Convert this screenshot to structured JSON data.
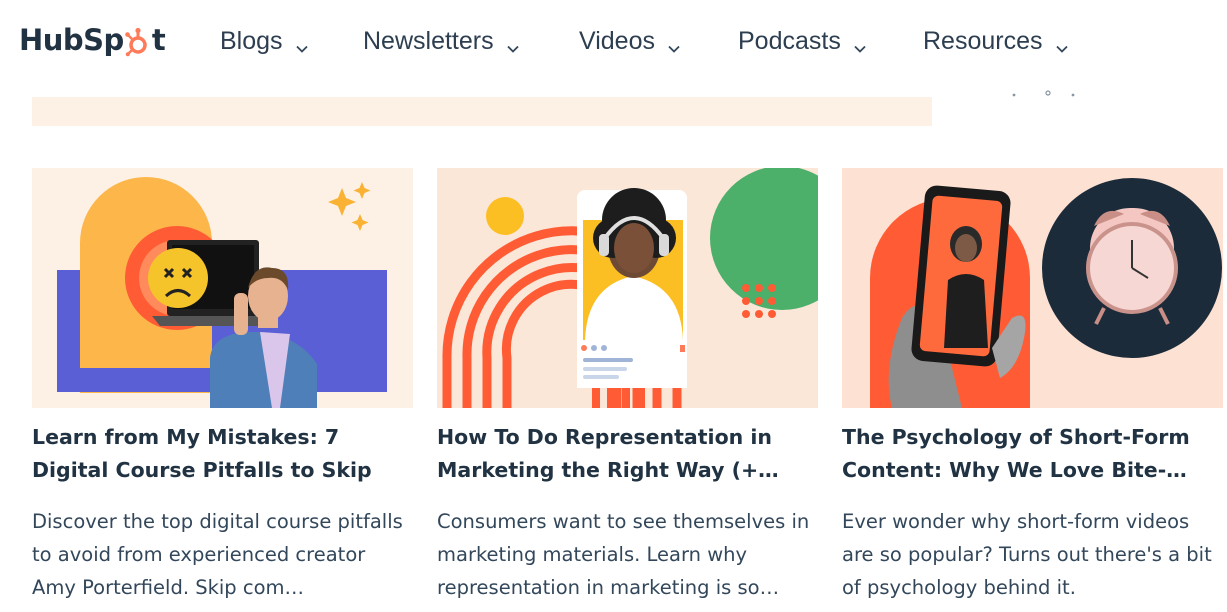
{
  "header": {
    "logo_text_left": "HubSp",
    "logo_text_right": "t",
    "nav": [
      {
        "label": "Blogs",
        "icon": "chevron-down-icon"
      },
      {
        "label": "Newsletters",
        "icon": "chevron-down-icon"
      },
      {
        "label": "Videos",
        "icon": "chevron-down-icon"
      },
      {
        "label": "Podcasts",
        "icon": "chevron-down-icon"
      },
      {
        "label": "Resources",
        "icon": "chevron-down-icon"
      }
    ]
  },
  "colors": {
    "brand_orange": "#ff7a59",
    "text_dark": "#213343",
    "banner_bg": "#fdf1e6"
  },
  "cards": [
    {
      "title": "Learn from My Mistakes: 7 Digital Course Pitfalls to Skip",
      "description": "Discover the top digital course pitfalls to avoid from experienced creator Amy Porterfield. Skip com…"
    },
    {
      "title": "How To Do Representation in Marketing the Right Way (+ Consu…",
      "description": "Consumers want to see themselves in marketing materials. Learn why representation in marketing is so…"
    },
    {
      "title": "The Psychology of Short-Form Content: Why We Love Bite-Sized…",
      "description": "Ever wonder why short-form videos are so popular? Turns out there's a bit of psychology behind it."
    }
  ]
}
